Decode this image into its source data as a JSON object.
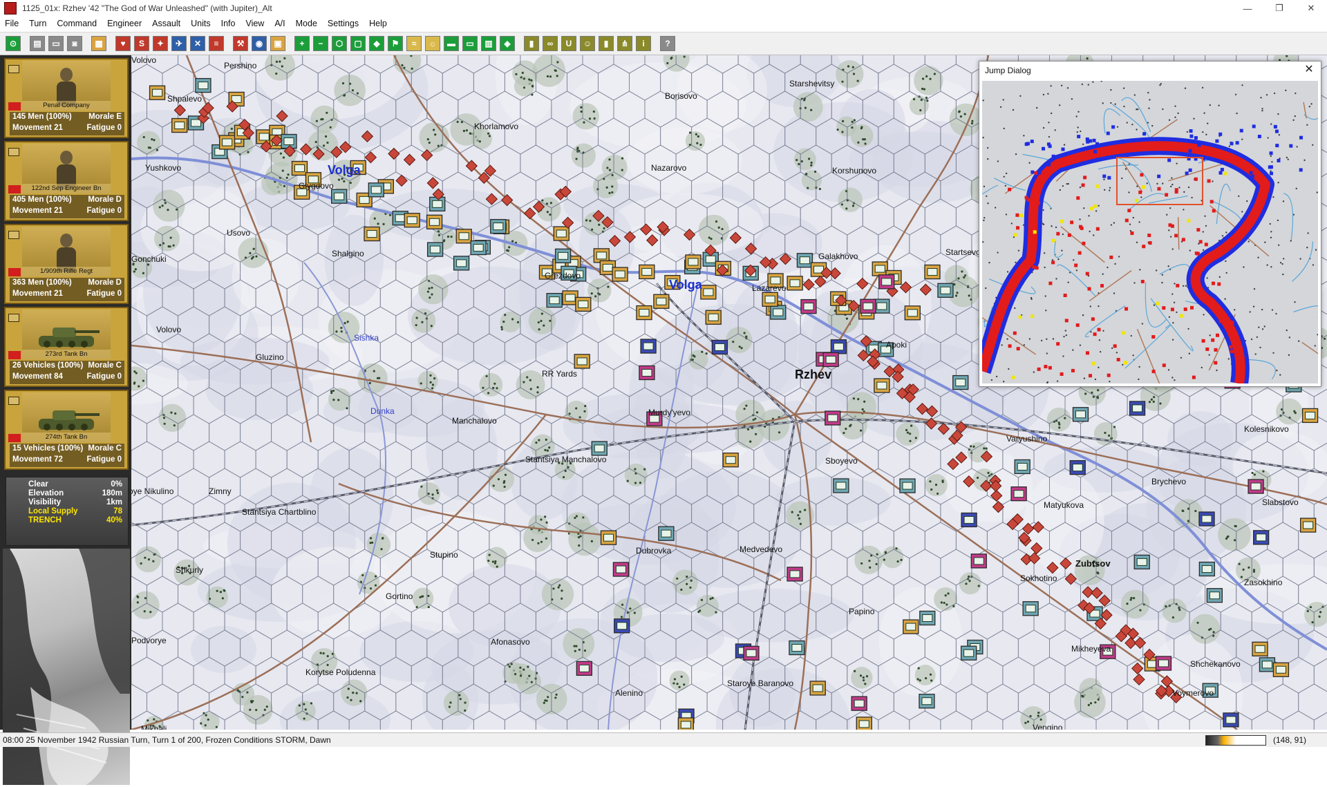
{
  "window": {
    "title": "1125_01x: Rzhev '42 \"The God of War Unleashed\" (with Jupiter)_Alt",
    "minimize": "—",
    "maximize": "❐",
    "close": "✕"
  },
  "menu": [
    "File",
    "Turn",
    "Command",
    "Engineer",
    "Assault",
    "Units",
    "Info",
    "View",
    "A/I",
    "Mode",
    "Settings",
    "Help"
  ],
  "toolbar": {
    "buttons": [
      {
        "icon": "target-icon",
        "color": "#1b9e3a"
      },
      {
        "icon": "gap"
      },
      {
        "icon": "save-icon",
        "color": "#8a8a8a"
      },
      {
        "icon": "open-icon",
        "color": "#8a8a8a"
      },
      {
        "icon": "record-icon",
        "color": "#8a8a8a"
      },
      {
        "icon": "gap"
      },
      {
        "icon": "unit-info-icon",
        "color": "#d9a441"
      },
      {
        "icon": "gap"
      },
      {
        "icon": "heart-icon",
        "color": "#c0392b"
      },
      {
        "icon": "strength-icon",
        "color": "#c0392b"
      },
      {
        "icon": "artillery-icon",
        "color": "#c0392b"
      },
      {
        "icon": "air-icon",
        "color": "#2e5fa8"
      },
      {
        "icon": "crossed-swords-icon",
        "color": "#2e5fa8"
      },
      {
        "icon": "stack-icon",
        "color": "#c0392b"
      },
      {
        "icon": "gap"
      },
      {
        "icon": "engineer-icon",
        "color": "#c0392b"
      },
      {
        "icon": "jump-icon",
        "color": "#2e5fa8"
      },
      {
        "icon": "report-icon",
        "color": "#d9a441"
      },
      {
        "icon": "gap"
      },
      {
        "icon": "zoom-in-icon",
        "color": "#1b9e3a"
      },
      {
        "icon": "zoom-out-icon",
        "color": "#1b9e3a"
      },
      {
        "icon": "hex-grid-icon",
        "color": "#1b9e3a"
      },
      {
        "icon": "fit-icon",
        "color": "#1b9e3a"
      },
      {
        "icon": "terrain-icon",
        "color": "#1b9e3a"
      },
      {
        "icon": "flag-icon",
        "color": "#1b9e3a"
      },
      {
        "icon": "bridge-icon",
        "color": "#d9b94a"
      },
      {
        "icon": "sun-icon",
        "color": "#d9b94a"
      },
      {
        "icon": "ground-icon",
        "color": "#1b9e3a"
      },
      {
        "icon": "monitor-icon",
        "color": "#1b9e3a"
      },
      {
        "icon": "map-icon",
        "color": "#1b9e3a"
      },
      {
        "icon": "objective-icon",
        "color": "#1b9e3a"
      },
      {
        "icon": "gap"
      },
      {
        "icon": "lock-icon",
        "color": "#8a8a2a"
      },
      {
        "icon": "binoculars-icon",
        "color": "#8a8a2a"
      },
      {
        "icon": "unit-icon",
        "color": "#8a8a2a"
      },
      {
        "icon": "smiley-icon",
        "color": "#8a8a2a"
      },
      {
        "icon": "building-icon",
        "color": "#8a8a2a"
      },
      {
        "icon": "hierarchy-icon",
        "color": "#8a8a2a"
      },
      {
        "icon": "info-box-icon",
        "color": "#8a8a2a"
      },
      {
        "icon": "gap"
      },
      {
        "icon": "help-icon",
        "color": "#8a8a8a"
      }
    ]
  },
  "units": [
    {
      "name": "Penal Company",
      "l1": "145 Men (100%)",
      "r1": "Morale E",
      "l2": "Movement 21",
      "r2": "Fatigue 0",
      "kind": "soldier"
    },
    {
      "name": "122nd Sep Engineer Bn",
      "l1": "405 Men (100%)",
      "r1": "Morale D",
      "l2": "Movement 21",
      "r2": "Fatigue 0",
      "kind": "soldier"
    },
    {
      "name": "1/909th Rifle Regt",
      "l1": "363 Men (100%)",
      "r1": "Morale D",
      "l2": "Movement 21",
      "r2": "Fatigue 0",
      "kind": "soldier"
    },
    {
      "name": "273rd Tank Bn",
      "l1": "26 Vehicles (100%)",
      "r1": "Morale C",
      "l2": "Movement 84",
      "r2": "Fatigue 0",
      "kind": "tank"
    },
    {
      "name": "274th Tank Bn",
      "l1": "15 Vehicles (100%)",
      "r1": "Morale C",
      "l2": "Movement 72",
      "r2": "Fatigue 0",
      "kind": "tank"
    }
  ],
  "terrain": [
    {
      "k": "Clear",
      "v": "0%",
      "hl": false
    },
    {
      "k": "Elevation",
      "v": "180m",
      "hl": false
    },
    {
      "k": "Visibility",
      "v": "1km",
      "hl": false
    },
    {
      "k": "Local Supply",
      "v": "78",
      "hl": true
    },
    {
      "k": "TRENCH",
      "v": "40%",
      "hl": true
    }
  ],
  "map": {
    "rivers": [
      "Volga",
      "Volga"
    ],
    "small_rivers": [
      "Sishka",
      "Dunka"
    ],
    "city": "Rzhev",
    "bold_towns": [
      "Zubtsov"
    ],
    "towns": [
      "Pershino",
      "Shpalevo",
      "Borisovo",
      "Starshevitsy",
      "Khorlamovo",
      "Yushkovo",
      "Nazarovo",
      "Glygdovo",
      "Korshunovo",
      "Usovo",
      "Shalgino",
      "Gonchuki",
      "Grezdovo",
      "Galakhovo",
      "Startsevo",
      "Lazarevo",
      "Apoki",
      "Volovo",
      "Gluzino",
      "RR Yards",
      "Murdy'yevo",
      "Manchalovo",
      "Stantsiya Manchalovo",
      "Sboyevo",
      "Varyushino",
      "Kolesnikovo",
      "Brychevo",
      "Slabstovo",
      "Matyukova",
      "oye Nikulino",
      "Zimny",
      "Stantsiya Chartblino",
      "Stupino",
      "Dubrovka",
      "Medvedevo",
      "Sokhotino",
      "Zasokhino",
      "Shkurly",
      "Papino",
      "Gortino",
      "Afonasovo",
      "Mikheyeva",
      "Shchekanovo",
      "Podvorye",
      "Korytse Poludenna",
      "Alenino",
      "Staroye Baranovo",
      "Voymerovo",
      "Mikhali",
      "Vengino",
      "Volovo"
    ],
    "counter_colors": {
      "soviet_infantry": "#d9a441",
      "german_teal": "#6fa6b3",
      "german_magenta": "#c23b8a",
      "german_blue": "#3b49b5",
      "soviet_diamond": "#c9473a"
    }
  },
  "jump_dialog": {
    "title": "Jump Dialog",
    "close": "✕",
    "front_colors": {
      "soviet": "#e21b1b",
      "german": "#1f2de0",
      "objective": "#f2e600"
    }
  },
  "statusbar": {
    "text": "08:00 25 November 1942 Russian Turn, Turn 1 of 200, Frozen Conditions STORM, Dawn",
    "turn_progress": 0.5,
    "coords": "(148, 91)"
  }
}
